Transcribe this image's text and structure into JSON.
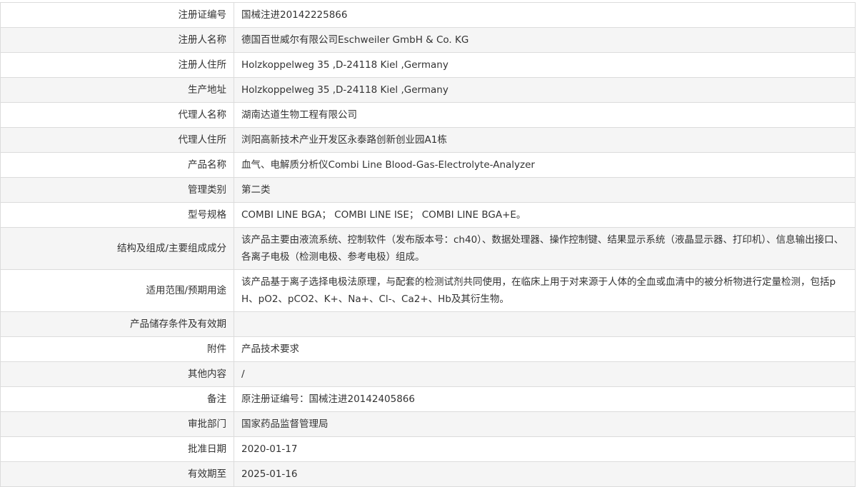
{
  "record": {
    "rows": [
      {
        "label": "注册证编号",
        "value": "国械注进20142225866"
      },
      {
        "label": "注册人名称",
        "value": "德国百世威尔有限公司Eschweiler GmbH & Co. KG"
      },
      {
        "label": "注册人住所",
        "value": "Holzkoppelweg 35 ,D-24118 Kiel ,Germany"
      },
      {
        "label": "生产地址",
        "value": "Holzkoppelweg 35 ,D-24118 Kiel ,Germany"
      },
      {
        "label": "代理人名称",
        "value": "湖南达道生物工程有限公司"
      },
      {
        "label": "代理人住所",
        "value": "浏阳高新技术产业开发区永泰路创新创业园A1栋"
      },
      {
        "label": "产品名称",
        "value": "血气、电解质分析仪Combi Line Blood-Gas-Electrolyte-Analyzer"
      },
      {
        "label": "管理类别",
        "value": "第二类"
      },
      {
        "label": "型号规格",
        "value": "COMBI LINE BGA； COMBI LINE ISE； COMBI LINE BGA+E。"
      },
      {
        "label": "结构及组成/主要组成成分",
        "value": "该产品主要由液流系统、控制软件（发布版本号：ch40）、数据处理器、操作控制键、结果显示系统（液晶显示器、打印机）、信息输出接口、各离子电极（检测电极、参考电极）组成。"
      },
      {
        "label": "适用范围/预期用途",
        "value": "该产品基于离子选择电极法原理，与配套的检测试剂共同使用，在临床上用于对来源于人体的全血或血清中的被分析物进行定量检测，包括pH、pO2、pCO2、K+、Na+、Cl-、Ca2+、Hb及其衍生物。"
      },
      {
        "label": "产品储存条件及有效期",
        "value": ""
      },
      {
        "label": "附件",
        "value": "产品技术要求"
      },
      {
        "label": "其他内容",
        "value": "/"
      },
      {
        "label": "备注",
        "value": "原注册证编号：国械注进20142405866"
      },
      {
        "label": "审批部门",
        "value": "国家药品监督管理局"
      },
      {
        "label": "批准日期",
        "value": "2020-01-17"
      },
      {
        "label": "有效期至",
        "value": "2025-01-16"
      }
    ]
  }
}
